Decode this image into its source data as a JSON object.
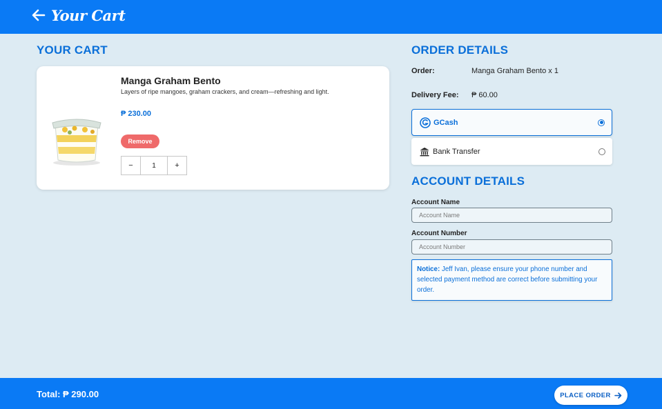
{
  "header": {
    "title": "Your Cart",
    "back_icon": "arrow-left-icon"
  },
  "cart": {
    "section_title": "YOUR CART",
    "item": {
      "name": "Manga Graham Bento",
      "description": "Layers of ripe mangoes, graham crackers, and cream—refreshing and light.",
      "price": "₱ 230.00",
      "remove_label": "Remove",
      "quantity": "1",
      "decrement_label": "−",
      "increment_label": "+"
    }
  },
  "order": {
    "section_title": "ORDER DETAILS",
    "order_label": "Order:",
    "order_value": "Manga Graham Bento x 1",
    "fee_label": "Delivery Fee:",
    "fee_value": "₱ 60.00",
    "payment_options": [
      {
        "label": "GCash",
        "icon": "gcash-icon",
        "selected": true
      },
      {
        "label": "Bank Transfer",
        "icon": "bank-icon",
        "selected": false
      }
    ]
  },
  "account": {
    "section_title": "ACCOUNT DETAILS",
    "name_label": "Account Name",
    "name_placeholder": "Account Name",
    "name_value": "",
    "number_label": "Account Number",
    "number_placeholder": "Account Number",
    "number_value": "",
    "notice_title": "Notice:",
    "notice_text": " Jeff Ivan, please ensure your phone number and selected payment method are correct before submitting your order."
  },
  "footer": {
    "total": "Total: ₱ 290.00",
    "place_order_label": "PLACE ORDER"
  },
  "colors": {
    "primary": "#0a7af5",
    "accent_text": "#0a6fd9",
    "remove": "#ef6a6a",
    "background": "#ddebf3"
  }
}
